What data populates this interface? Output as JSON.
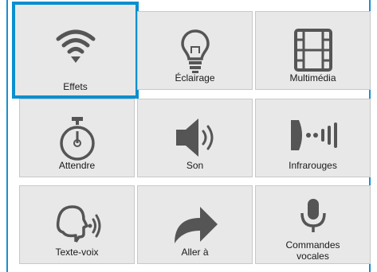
{
  "tiles": [
    {
      "label": "Effets",
      "icon": "wifi-icon",
      "selected": true
    },
    {
      "label": "Éclairage",
      "icon": "lightbulb-icon",
      "selected": false
    },
    {
      "label": "Multimédia",
      "icon": "film-icon",
      "selected": false
    },
    {
      "label": "Attendre",
      "icon": "stopwatch-icon",
      "selected": false
    },
    {
      "label": "Son",
      "icon": "speaker-icon",
      "selected": false
    },
    {
      "label": "Infrarouges",
      "icon": "infrared-icon",
      "selected": false
    },
    {
      "label": "Texte-voix",
      "icon": "speaking-head-icon",
      "selected": false
    },
    {
      "label": "Aller à",
      "icon": "redo-arrow-icon",
      "selected": false
    },
    {
      "label": "Commandes vocales",
      "icon": "microphone-icon",
      "selected": false
    }
  ],
  "colors": {
    "selection_border": "#0a8fcf",
    "tile_background": "#e8e8e8",
    "icon_color": "#555555"
  }
}
